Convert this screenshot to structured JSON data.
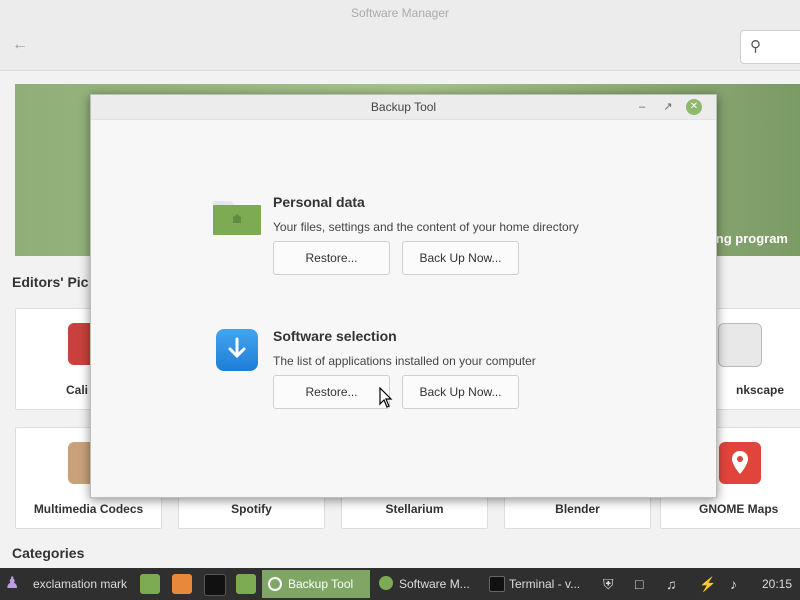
{
  "software_manager": {
    "title": "Software Manager",
    "banner_text": "ng program",
    "editors_picks_title": "Editors' Pic",
    "categories_title": "Categories",
    "row1": [
      {
        "label": "Cali",
        "icon": "book-icon"
      },
      {
        "label": "nkscape",
        "icon": "inkscape-icon"
      }
    ],
    "row2": [
      {
        "label": "Multimedia Codecs",
        "icon": "package-icon"
      },
      {
        "label": "Spotify",
        "icon": "spotify-icon"
      },
      {
        "label": "Stellarium",
        "icon": "stellarium-icon"
      },
      {
        "label": "Blender",
        "icon": "blender-icon"
      },
      {
        "label": "GNOME Maps",
        "icon": "map-pin-icon"
      }
    ]
  },
  "dialog": {
    "title": "Backup Tool",
    "personal": {
      "heading": "Personal data",
      "description": "Your files, settings and the content of your home directory",
      "restore_label": "Restore...",
      "backup_label": "Back Up Now..."
    },
    "software": {
      "heading": "Software selection",
      "description": "The list of applications installed on your computer",
      "restore_label": "Restore...",
      "backup_label": "Back Up Now..."
    }
  },
  "taskbar": {
    "menu_label": "exclamation mark",
    "windows": [
      {
        "label": "Backup Tool",
        "active": true
      },
      {
        "label": "Software M...",
        "active": false
      },
      {
        "label": "Terminal - v...",
        "active": false
      }
    ],
    "clock": "20:15"
  },
  "colors": {
    "accent": "#7fa665",
    "folder_green": "#7cab54",
    "download_blue": "#2b8ee0",
    "taskbar_bg": "#2f2f2f"
  }
}
